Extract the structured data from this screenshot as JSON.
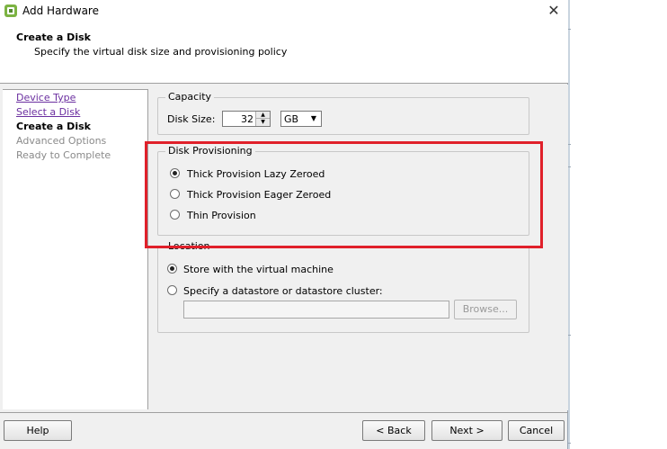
{
  "window": {
    "title": "Add Hardware"
  },
  "header": {
    "title": "Create a Disk",
    "subtitle": "Specify the virtual disk size and provisioning policy"
  },
  "nav": {
    "items": [
      {
        "label": "Device Type",
        "state": "link"
      },
      {
        "label": "Select a Disk",
        "state": "link"
      },
      {
        "label": "Create a Disk",
        "state": "current"
      },
      {
        "label": "Advanced Options",
        "state": "disabled"
      },
      {
        "label": "Ready to Complete",
        "state": "disabled"
      }
    ]
  },
  "capacity": {
    "legend": "Capacity",
    "disk_size_label": "Disk Size:",
    "disk_size_value": "32",
    "unit": "GB"
  },
  "provisioning": {
    "legend": "Disk Provisioning",
    "options": [
      {
        "label": "Thick Provision Lazy Zeroed",
        "checked": true
      },
      {
        "label": "Thick Provision Eager Zeroed",
        "checked": false
      },
      {
        "label": "Thin Provision",
        "checked": false
      }
    ]
  },
  "location": {
    "legend": "Location",
    "options": [
      {
        "label": "Store with the virtual machine",
        "checked": true
      },
      {
        "label": "Specify a datastore or datastore cluster:",
        "checked": false
      }
    ],
    "datastore_value": "",
    "browse_label": "Browse..."
  },
  "footer": {
    "help_label": "Help",
    "back_label": "< Back",
    "next_label": "Next >",
    "cancel_label": "Cancel"
  },
  "colors": {
    "highlight": "#e0202a",
    "link": "#6b2fa0"
  }
}
